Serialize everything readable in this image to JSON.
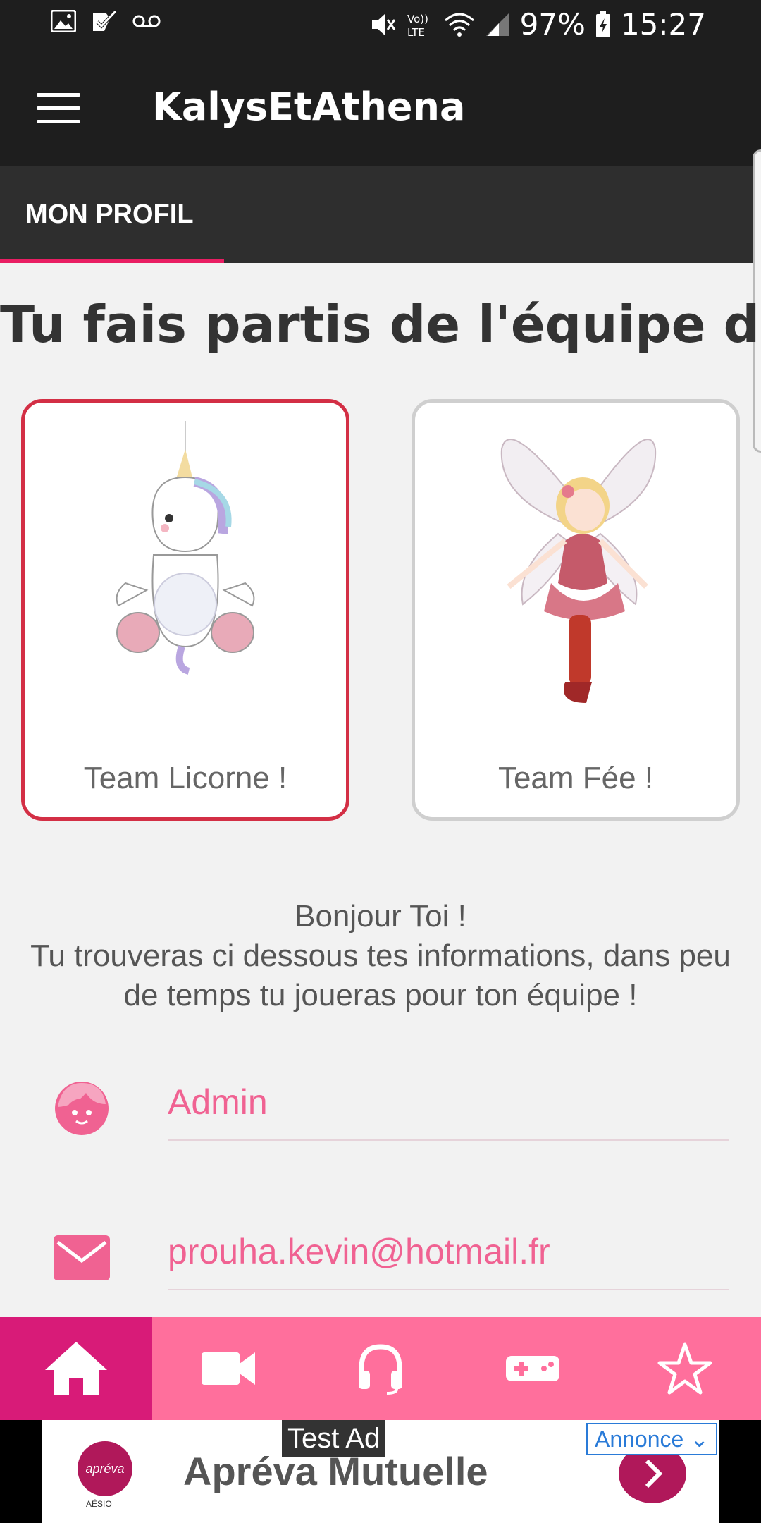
{
  "status_bar": {
    "battery": "97%",
    "time": "15:27"
  },
  "app_bar": {
    "title": "KalysEtAthena"
  },
  "tabs": [
    {
      "label": "MON PROFIL"
    }
  ],
  "heading": "Tu fais partis de l'équipe de",
  "teams": [
    {
      "label": "Team Licorne !",
      "selected": true
    },
    {
      "label": "Team Fée !",
      "selected": false
    }
  ],
  "greeting": {
    "line1": "Bonjour Toi !",
    "line2": "Tu trouveras ci dessous tes informations, dans peu de temps tu joueras pour ton équipe !"
  },
  "profile": {
    "name": "Admin",
    "email": "prouha.kevin@hotmail.fr"
  },
  "bottom_nav": [
    {
      "icon": "home-icon",
      "active": true
    },
    {
      "icon": "video-camera-icon",
      "active": false
    },
    {
      "icon": "headphones-icon",
      "active": false
    },
    {
      "icon": "gamepad-icon",
      "active": false
    },
    {
      "icon": "star-icon",
      "active": false
    }
  ],
  "ad": {
    "test_label": "Test Ad",
    "badge": "Annonce",
    "title": "Apréva Mutuelle",
    "logo_text": "apréva",
    "logo_sub": "AÉSIO"
  },
  "colors": {
    "accent": "#e91e63",
    "nav_bg": "#ff6f9c",
    "nav_active": "#d81b78",
    "field_text": "#f06292",
    "selected_border": "#d32f45"
  }
}
